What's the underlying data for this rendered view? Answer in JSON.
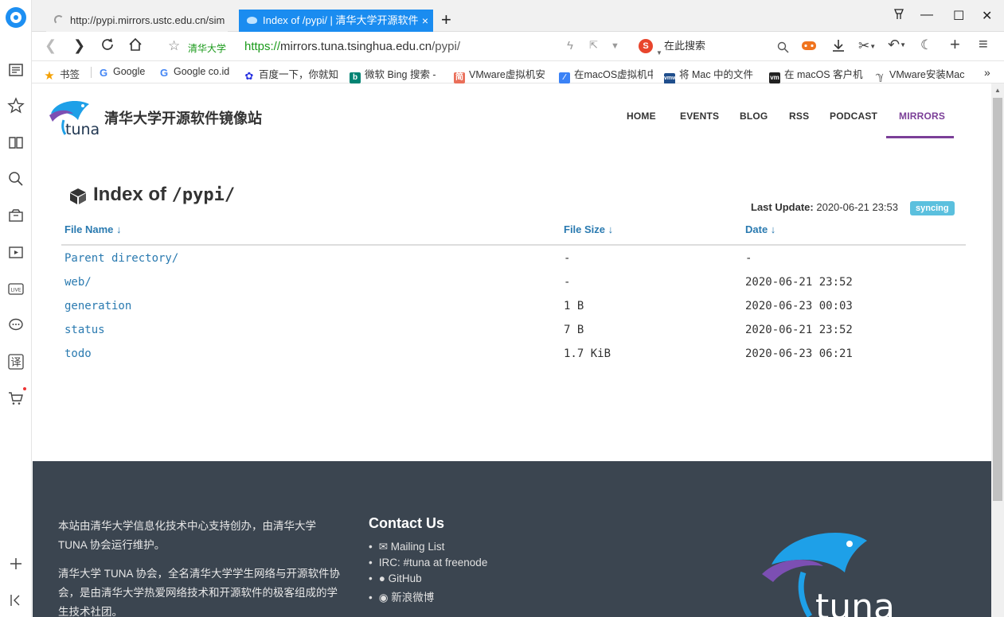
{
  "tabs": [
    {
      "title": "http://pypi.mirrors.ustc.edu.cn/sim",
      "close": ""
    },
    {
      "title": "Index of /pypi/ | 清华大学开源软件",
      "close": "×"
    }
  ],
  "newtab": "+",
  "window": {
    "pin": "⏷",
    "min": "—",
    "max": "☐",
    "close": "✕"
  },
  "address": {
    "site_label": "清华大学",
    "url_scheme": "https://",
    "url_host": "mirrors.tuna.tsinghua.edu.cn",
    "url_path": "/pypi/",
    "search_placeholder": "在此搜索",
    "search_logo": "S"
  },
  "bookmarks": [
    {
      "label": "书签",
      "icon": "star-icon",
      "color": "#f4a000"
    },
    {
      "label": "Google",
      "icon": "google-icon",
      "color": "#4285f4"
    },
    {
      "label": "Google co.id",
      "icon": "google-icon",
      "color": "#4285f4"
    },
    {
      "label": "百度一下，你就知",
      "icon": "baidu-icon",
      "color": "#2932e1"
    },
    {
      "label": "微软 Bing 搜索 -",
      "icon": "bing-icon",
      "color": "#008373"
    },
    {
      "label": "VMware虚拟机安",
      "icon": "jianshu-icon",
      "color": "#ea6f5a"
    },
    {
      "label": "在macOS虚拟机中",
      "icon": "edit-icon",
      "color": "#3b82f6"
    },
    {
      "label": "将 Mac 中的文件",
      "icon": "vmware-icon",
      "color": "#1f4e8c"
    },
    {
      "label": "在 macOS 客户机",
      "icon": "vmware-icon",
      "color": "#222"
    },
    {
      "label": "VMware安装Mac",
      "icon": "doc-icon",
      "color": "#666"
    }
  ],
  "site": {
    "brand": "清华大学开源软件镜像站",
    "menu": [
      "HOME",
      "EVENTS",
      "BLOG",
      "RSS",
      "PODCAST",
      "MIRRORS"
    ],
    "active_menu": "MIRRORS"
  },
  "index": {
    "title_prefix": "Index of ",
    "title_path": "/pypi/",
    "last_update_label": "Last Update:",
    "last_update_value": "2020-06-21 23:53",
    "status": "syncing",
    "columns": [
      "File Name ↓",
      "File Size ↓",
      "Date ↓"
    ],
    "rows": [
      {
        "name": "Parent directory/",
        "size": "-",
        "date": "-"
      },
      {
        "name": "web/",
        "size": "-",
        "date": "2020-06-21 23:52"
      },
      {
        "name": "generation",
        "size": "1 B",
        "date": "2020-06-23 00:03"
      },
      {
        "name": "status",
        "size": "7 B",
        "date": "2020-06-21 23:52"
      },
      {
        "name": "todo",
        "size": "1.7 KiB",
        "date": "2020-06-23 06:21"
      }
    ]
  },
  "footer": {
    "para1": "本站由清华大学信息化技术中心支持创办，由清华大学 TUNA 协会运行维护。",
    "para2": "清华大学 TUNA 协会，全名清华大学学生网络与开源软件协会，是由清华大学热爱网络技术和开源软件的极客组成的学生技术社团。",
    "contact_title": "Contact Us",
    "contacts": [
      "Mailing List",
      "IRC: #tuna at freenode",
      "GitHub",
      "新浪微博"
    ]
  },
  "colors": {
    "accent": "#7b3f98",
    "link": "#2a7ab0",
    "tab_active": "#1a8cf0",
    "footer_bg": "#3b4550",
    "badge": "#5bc0de"
  }
}
